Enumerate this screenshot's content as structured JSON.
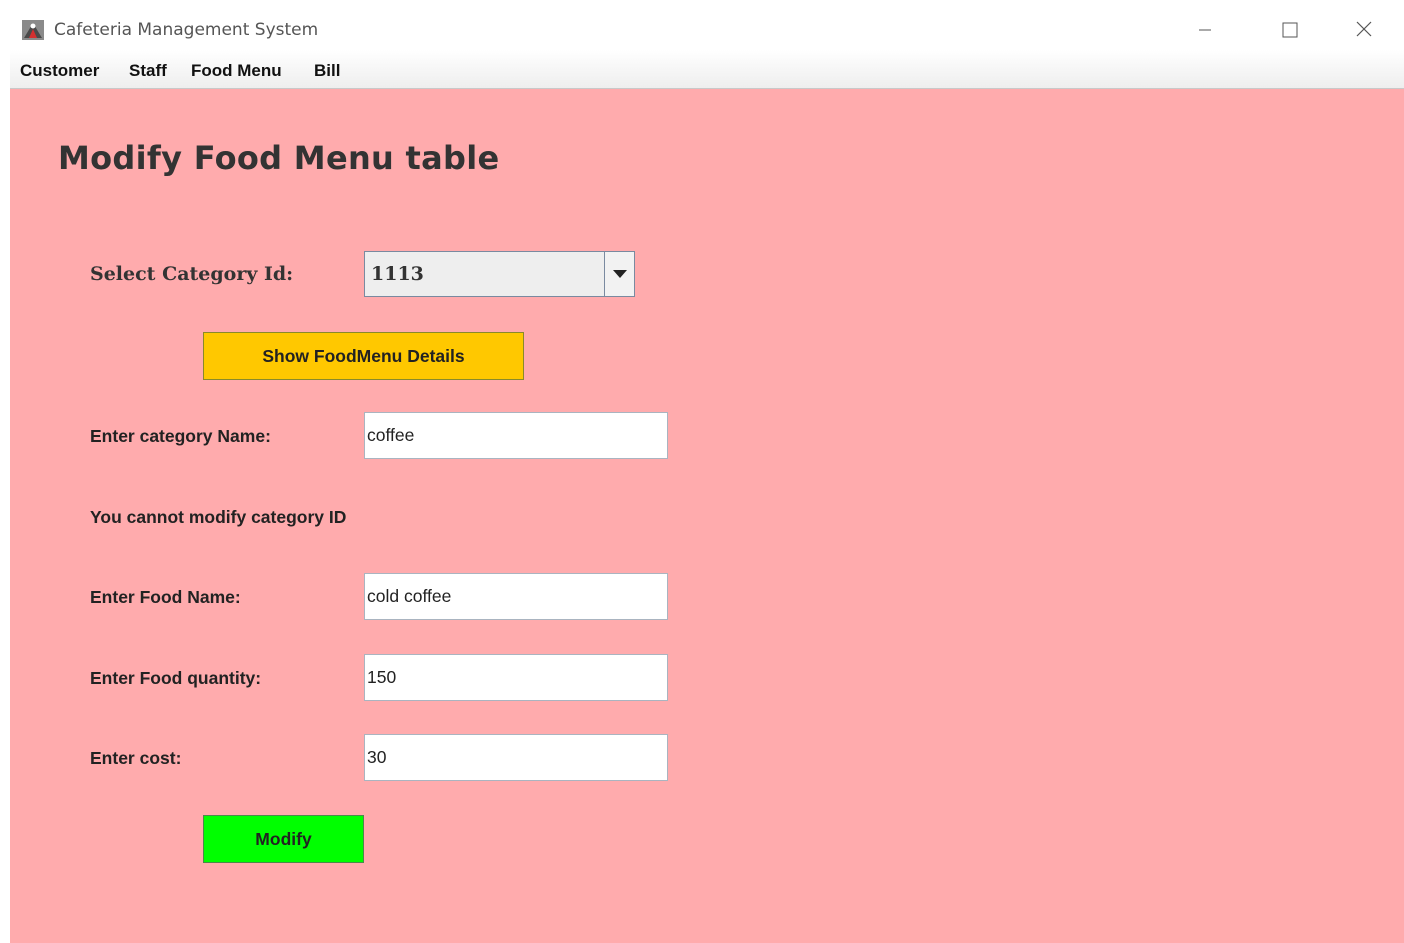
{
  "window": {
    "title": "Cafeteria Management System",
    "icon": "java-app-icon"
  },
  "menubar": {
    "items": [
      {
        "label": "Customer"
      },
      {
        "label": "Staff"
      },
      {
        "label": "Food Menu"
      },
      {
        "label": "Bill"
      }
    ]
  },
  "form": {
    "heading": "Modify Food Menu table",
    "category_select": {
      "label": "Select Category Id:",
      "value": "1113"
    },
    "show_button": "Show FoodMenu Details",
    "category_name": {
      "label": "Enter category Name:",
      "value": "coffee"
    },
    "note": "You cannot modify category ID",
    "food_name": {
      "label": "Enter Food Name:",
      "value": "cold coffee"
    },
    "food_quantity": {
      "label": "Enter Food quantity:",
      "value": "150"
    },
    "cost": {
      "label": "Enter cost:",
      "value": "30"
    },
    "modify_button": "Modify"
  },
  "colors": {
    "content_background": "#ffabad",
    "show_button": "#ffc800",
    "modify_button": "#00ff00"
  }
}
